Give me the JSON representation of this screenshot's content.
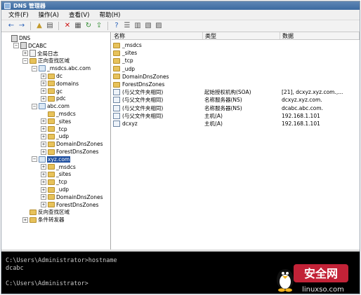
{
  "window": {
    "title": "DNS 管理器"
  },
  "menu": [
    "文件(F)",
    "操作(A)",
    "查看(V)",
    "帮助(H)"
  ],
  "toolbar": [
    {
      "icon": "back-icon",
      "color": "#2a62b8",
      "glyph": "←"
    },
    {
      "icon": "forward-icon",
      "color": "#2a62b8",
      "glyph": "→"
    },
    {
      "icon": "up-folder-icon",
      "color": "#c39a2c",
      "glyph": "▲"
    },
    {
      "icon": "console-tree-icon",
      "color": "#555555",
      "glyph": "▤"
    },
    {
      "icon": "delete-icon",
      "color": "#cc1111",
      "glyph": "✕"
    },
    {
      "icon": "properties-icon",
      "color": "#555555",
      "glyph": "▦"
    },
    {
      "icon": "refresh-icon",
      "color": "#2f8a2f",
      "glyph": "↻"
    },
    {
      "icon": "export-icon",
      "color": "#2f8a2f",
      "glyph": "⇪"
    },
    {
      "icon": "help-icon",
      "color": "#2a62b8",
      "glyph": "?"
    },
    {
      "icon": "list-icon",
      "color": "#555555",
      "glyph": "☰"
    },
    {
      "icon": "new-record-icon",
      "color": "#555555",
      "glyph": "▥"
    },
    {
      "icon": "new-zone-icon",
      "color": "#555555",
      "glyph": "▧"
    },
    {
      "icon": "filter-icon",
      "color": "#555555",
      "glyph": "▨"
    }
  ],
  "tree": [
    {
      "label": "DNS",
      "depth": 0,
      "icon": "dns-icon",
      "expander": ""
    },
    {
      "label": "DCABC",
      "depth": 1,
      "icon": "server-icon",
      "expander": "−"
    },
    {
      "label": "全局日志",
      "depth": 2,
      "icon": "log-icon",
      "expander": "+"
    },
    {
      "label": "正向查找区域",
      "depth": 2,
      "icon": "folder-icon",
      "expander": "−"
    },
    {
      "label": "_msdcs.abc.com",
      "depth": 3,
      "icon": "zone-icon",
      "expander": "−"
    },
    {
      "label": "dc",
      "depth": 4,
      "icon": "folder-icon",
      "expander": "+"
    },
    {
      "label": "domains",
      "depth": 4,
      "icon": "folder-icon",
      "expander": "+"
    },
    {
      "label": "gc",
      "depth": 4,
      "icon": "folder-icon",
      "expander": "+"
    },
    {
      "label": "pdc",
      "depth": 4,
      "icon": "folder-icon",
      "expander": "+"
    },
    {
      "label": "abc.com",
      "depth": 3,
      "icon": "zone-icon",
      "expander": "−"
    },
    {
      "label": "_msdcs",
      "depth": 4,
      "icon": "folder-icon",
      "expander": ""
    },
    {
      "label": "_sites",
      "depth": 4,
      "icon": "folder-icon",
      "expander": "+"
    },
    {
      "label": "_tcp",
      "depth": 4,
      "icon": "folder-icon",
      "expander": "+"
    },
    {
      "label": "_udp",
      "depth": 4,
      "icon": "folder-icon",
      "expander": "+"
    },
    {
      "label": "DomainDnsZones",
      "depth": 4,
      "icon": "folder-icon",
      "expander": "+"
    },
    {
      "label": "ForestDnsZones",
      "depth": 4,
      "icon": "folder-icon",
      "expander": "+"
    },
    {
      "label": "xyz.com",
      "depth": 3,
      "icon": "zone-icon",
      "expander": "−",
      "selected": true
    },
    {
      "label": "_msdcs",
      "depth": 4,
      "icon": "folder-icon",
      "expander": "+"
    },
    {
      "label": "_sites",
      "depth": 4,
      "icon": "folder-icon",
      "expander": "+"
    },
    {
      "label": "_tcp",
      "depth": 4,
      "icon": "folder-icon",
      "expander": "+"
    },
    {
      "label": "_udp",
      "depth": 4,
      "icon": "folder-icon",
      "expander": "+"
    },
    {
      "label": "DomainDnsZones",
      "depth": 4,
      "icon": "folder-icon",
      "expander": "+"
    },
    {
      "label": "ForestDnsZones",
      "depth": 4,
      "icon": "folder-icon",
      "expander": "+"
    },
    {
      "label": "反向查找区域",
      "depth": 2,
      "icon": "folder-icon",
      "expander": ""
    },
    {
      "label": "条件转发器",
      "depth": 2,
      "icon": "folder-icon",
      "expander": "+"
    }
  ],
  "list": {
    "columns": [
      "名称",
      "类型",
      "数据"
    ],
    "rows": [
      {
        "name": "_msdcs",
        "type": "",
        "data": "",
        "icon": "folder-icon"
      },
      {
        "name": "_sites",
        "type": "",
        "data": "",
        "icon": "folder-icon"
      },
      {
        "name": "_tcp",
        "type": "",
        "data": "",
        "icon": "folder-icon"
      },
      {
        "name": "_udp",
        "type": "",
        "data": "",
        "icon": "folder-icon"
      },
      {
        "name": "DomainDnsZones",
        "type": "",
        "data": "",
        "icon": "folder-icon"
      },
      {
        "name": "ForestDnsZones",
        "type": "",
        "data": "",
        "icon": "folder-icon"
      },
      {
        "name": "(与父文件夹相同)",
        "type": "起始授权机构(SOA)",
        "data": "[21], dcxyz.xyz.com.,...",
        "icon": "record-icon"
      },
      {
        "name": "(与父文件夹相同)",
        "type": "名称服务器(NS)",
        "data": "dcxyz.xyz.com.",
        "icon": "record-icon"
      },
      {
        "name": "(与父文件夹相同)",
        "type": "名称服务器(NS)",
        "data": "dcabc.abc.com.",
        "icon": "record-icon"
      },
      {
        "name": "(与父文件夹相同)",
        "type": "主机(A)",
        "data": "192.168.1.101",
        "icon": "record-icon"
      },
      {
        "name": "dcxyz",
        "type": "主机(A)",
        "data": "192.168.1.101",
        "icon": "record-icon"
      }
    ]
  },
  "console": {
    "lines": [
      "C:\\Users\\Administrator>hostname",
      "dcabc",
      "",
      "C:\\Users\\Administrator>"
    ]
  },
  "watermark": {
    "title": "安全网",
    "url": "linuxso.com"
  }
}
